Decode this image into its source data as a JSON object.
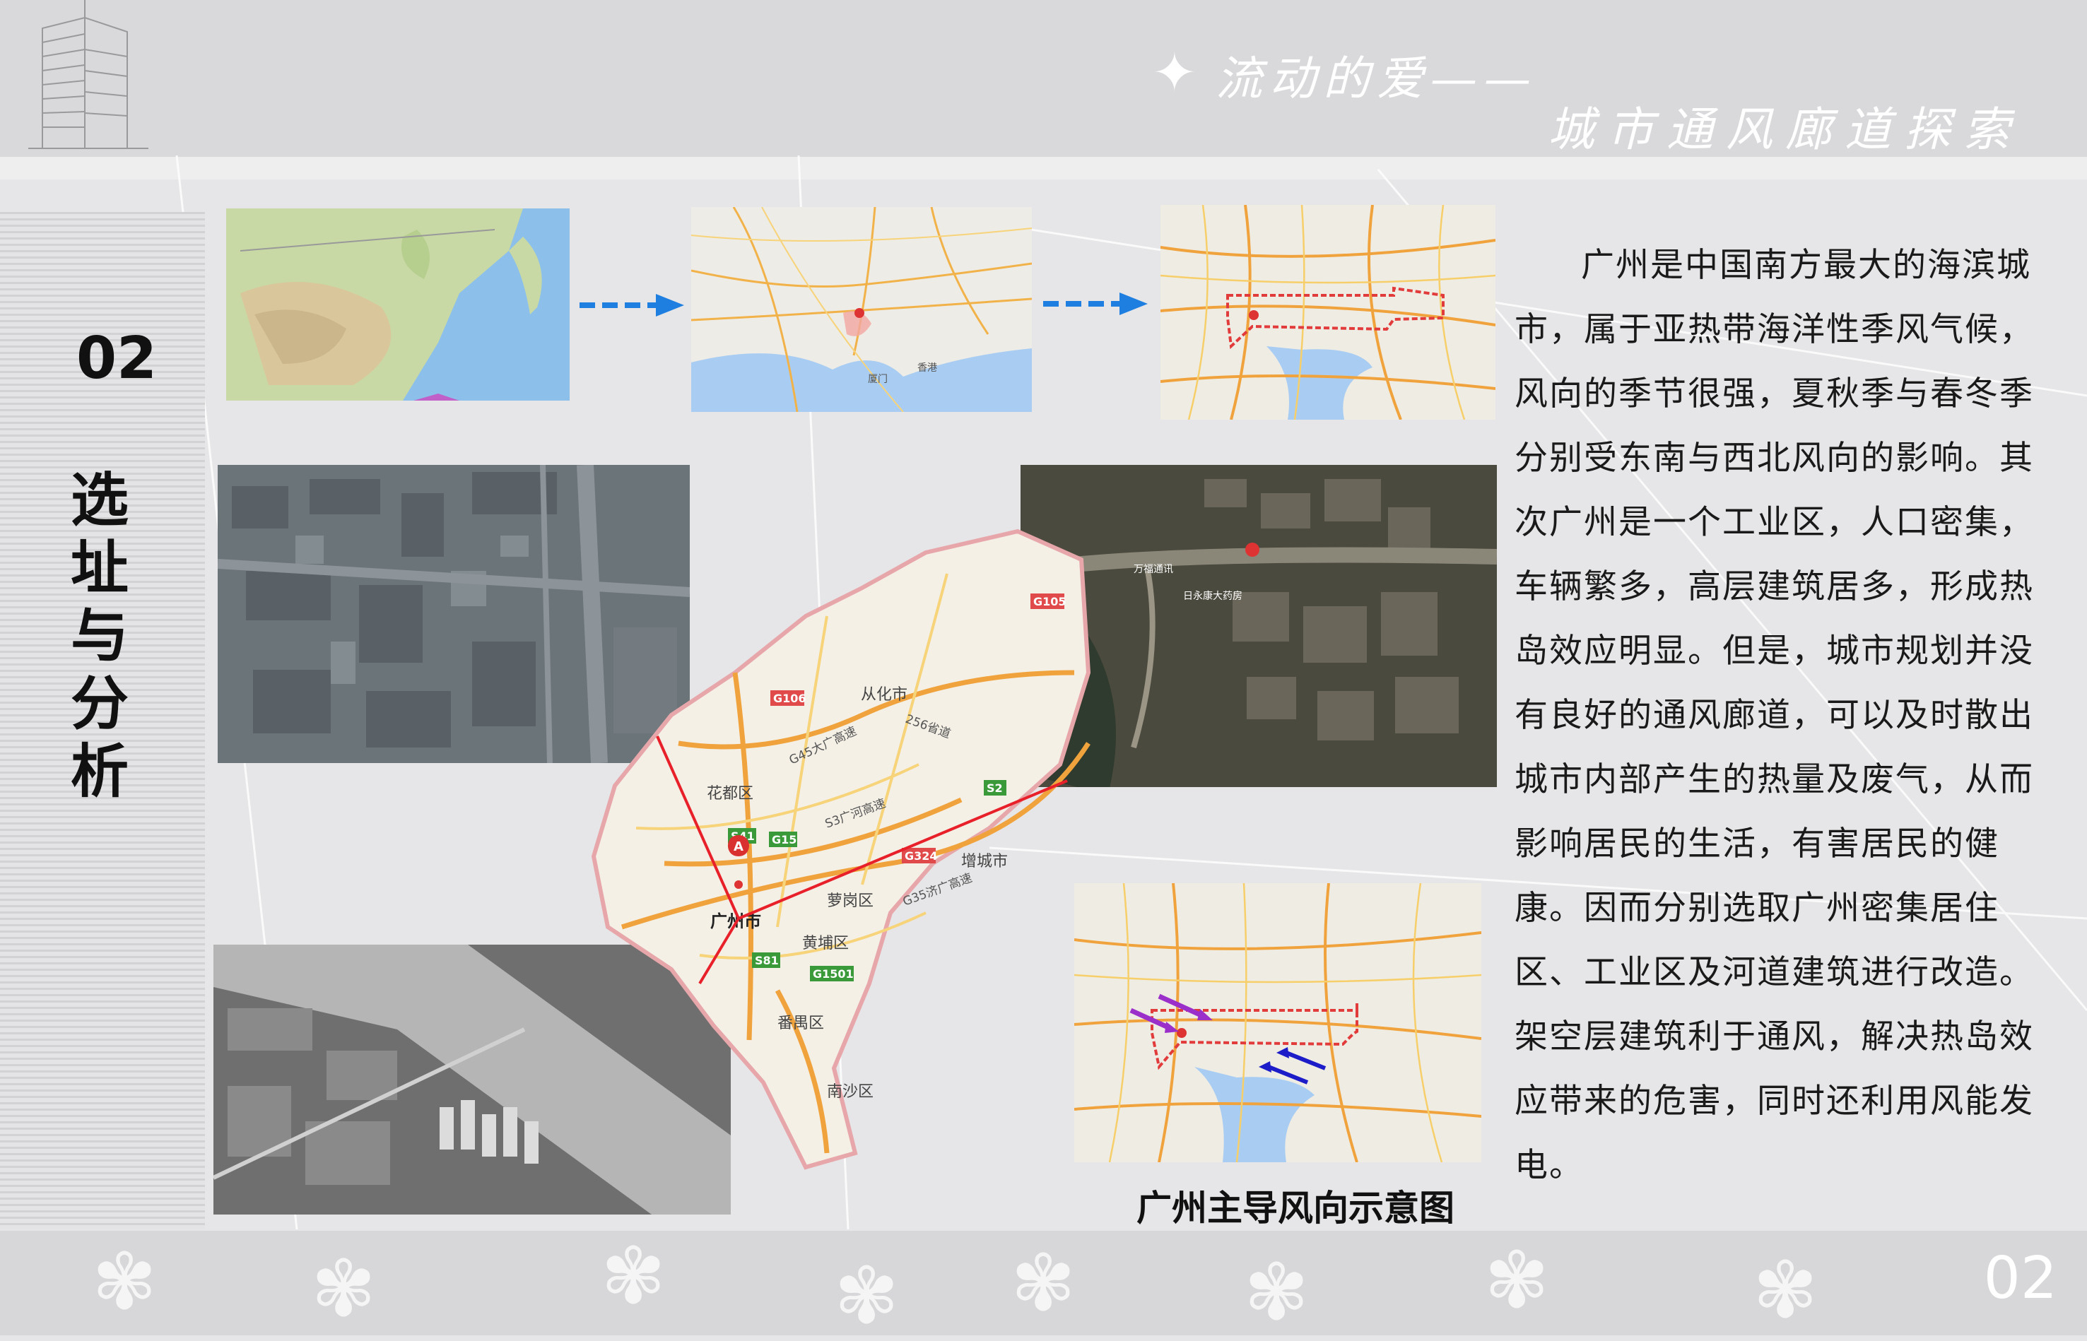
{
  "header": {
    "title_line1": "流动的爱——",
    "title_line2": "城市通风廊道探索"
  },
  "sidebar": {
    "section_number": "02",
    "section_title_chars": [
      "选",
      "址",
      "与",
      "分",
      "析"
    ]
  },
  "maps": {
    "guangzhou_labels": [
      "花都区",
      "从化市",
      "增城市",
      "广州市",
      "萝岗区",
      "黄埔区",
      "番禺区",
      "南沙区"
    ],
    "guangzhou_highways": [
      "G106",
      "G105",
      "G15",
      "S41",
      "S2",
      "S81",
      "G1501",
      "G324",
      "G45大广高速",
      "256省道",
      "G35济广高速",
      "S3广河高速"
    ],
    "marker_label": "A",
    "regional_labels": [
      "厦门",
      "香港"
    ],
    "satellite_labels": [
      "万福通讯",
      "日永康大药房"
    ]
  },
  "caption": "广州主导风向示意图",
  "body": {
    "paragraph": "广州是中国南方最大的海滨城市，属于亚热带海洋性季风气候，风向的季节很强，夏秋季与春冬季分别受东南与西北风向的影响。其次广州是一个工业区，人口密集，车辆繁多，高层建筑居多，形成热岛效应明显。但是，城市规划并没有良好的通风廊道，可以及时散出城市内部产生的热量及废气，从而影响居民的生活，有害居民的健康。因而分别选取广州密集居住区、工业区及河道建筑进行改造。架空层建筑利于通风，解决热岛效应带来的危害，同时还利用风能发电。"
  },
  "footer": {
    "page_number": "02"
  },
  "colors": {
    "arrow_blue": "#1e7fe0",
    "connector_red": "#e8202a",
    "boundary_red": "#e23b3b",
    "wind_purple": "#9b2fc9",
    "wind_blue": "#1c1cc8"
  }
}
